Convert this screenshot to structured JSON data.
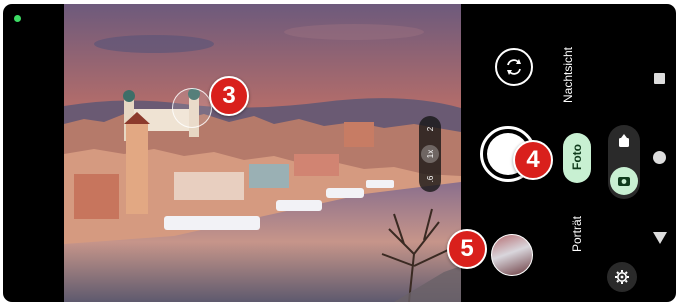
{
  "viewfinder": {
    "zoom_options": [
      "2",
      "1x",
      ".6"
    ],
    "zoom_selected": "1x"
  },
  "modes": {
    "night": "Nachtsicht",
    "photo": "Foto",
    "portrait": "Porträt",
    "selected": "Foto"
  },
  "capture_type": {
    "options": [
      "video",
      "photo"
    ],
    "selected": "photo"
  },
  "annotations": [
    "3",
    "4",
    "5"
  ],
  "colors": {
    "background": "#000000",
    "accent": "#c8f0d2",
    "badge": "#d9201c",
    "status_dot": "#3ddc65"
  },
  "icons": {
    "flip_camera": "flip-camera-icon",
    "video": "video-camera-icon",
    "photo": "photo-camera-icon",
    "settings": "settings-gear-icon",
    "nav_back": "nav-back-icon",
    "nav_home": "nav-home-icon",
    "nav_recents": "nav-recents-icon"
  }
}
